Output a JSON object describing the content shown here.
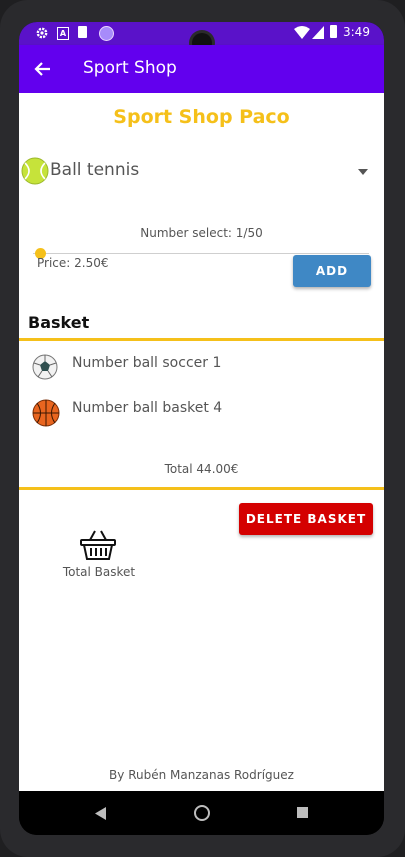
{
  "status_bar": {
    "time": "3:49"
  },
  "app_bar": {
    "title": "Sport Shop"
  },
  "shop": {
    "title": "Sport Shop Paco",
    "title_color": "#f5c01a"
  },
  "product_select": {
    "selected": "Ball tennis"
  },
  "quantity": {
    "label": "Number select: 1/50",
    "slider_fraction": 0.02
  },
  "price": {
    "label": "Price: 2.50€"
  },
  "add_button": {
    "label": "ADD"
  },
  "basket": {
    "title": "Basket",
    "items": [
      {
        "label": "Number ball soccer 1",
        "icon": "soccer-ball-icon"
      },
      {
        "label": "Number ball basket 4",
        "icon": "basketball-icon"
      }
    ],
    "total": "Total 44.00€"
  },
  "total_basket": {
    "label": "Total Basket"
  },
  "delete_button": {
    "label": "DELETE BASKET"
  },
  "footer": {
    "credit": "By Rubén Manzanas Rodríguez"
  }
}
